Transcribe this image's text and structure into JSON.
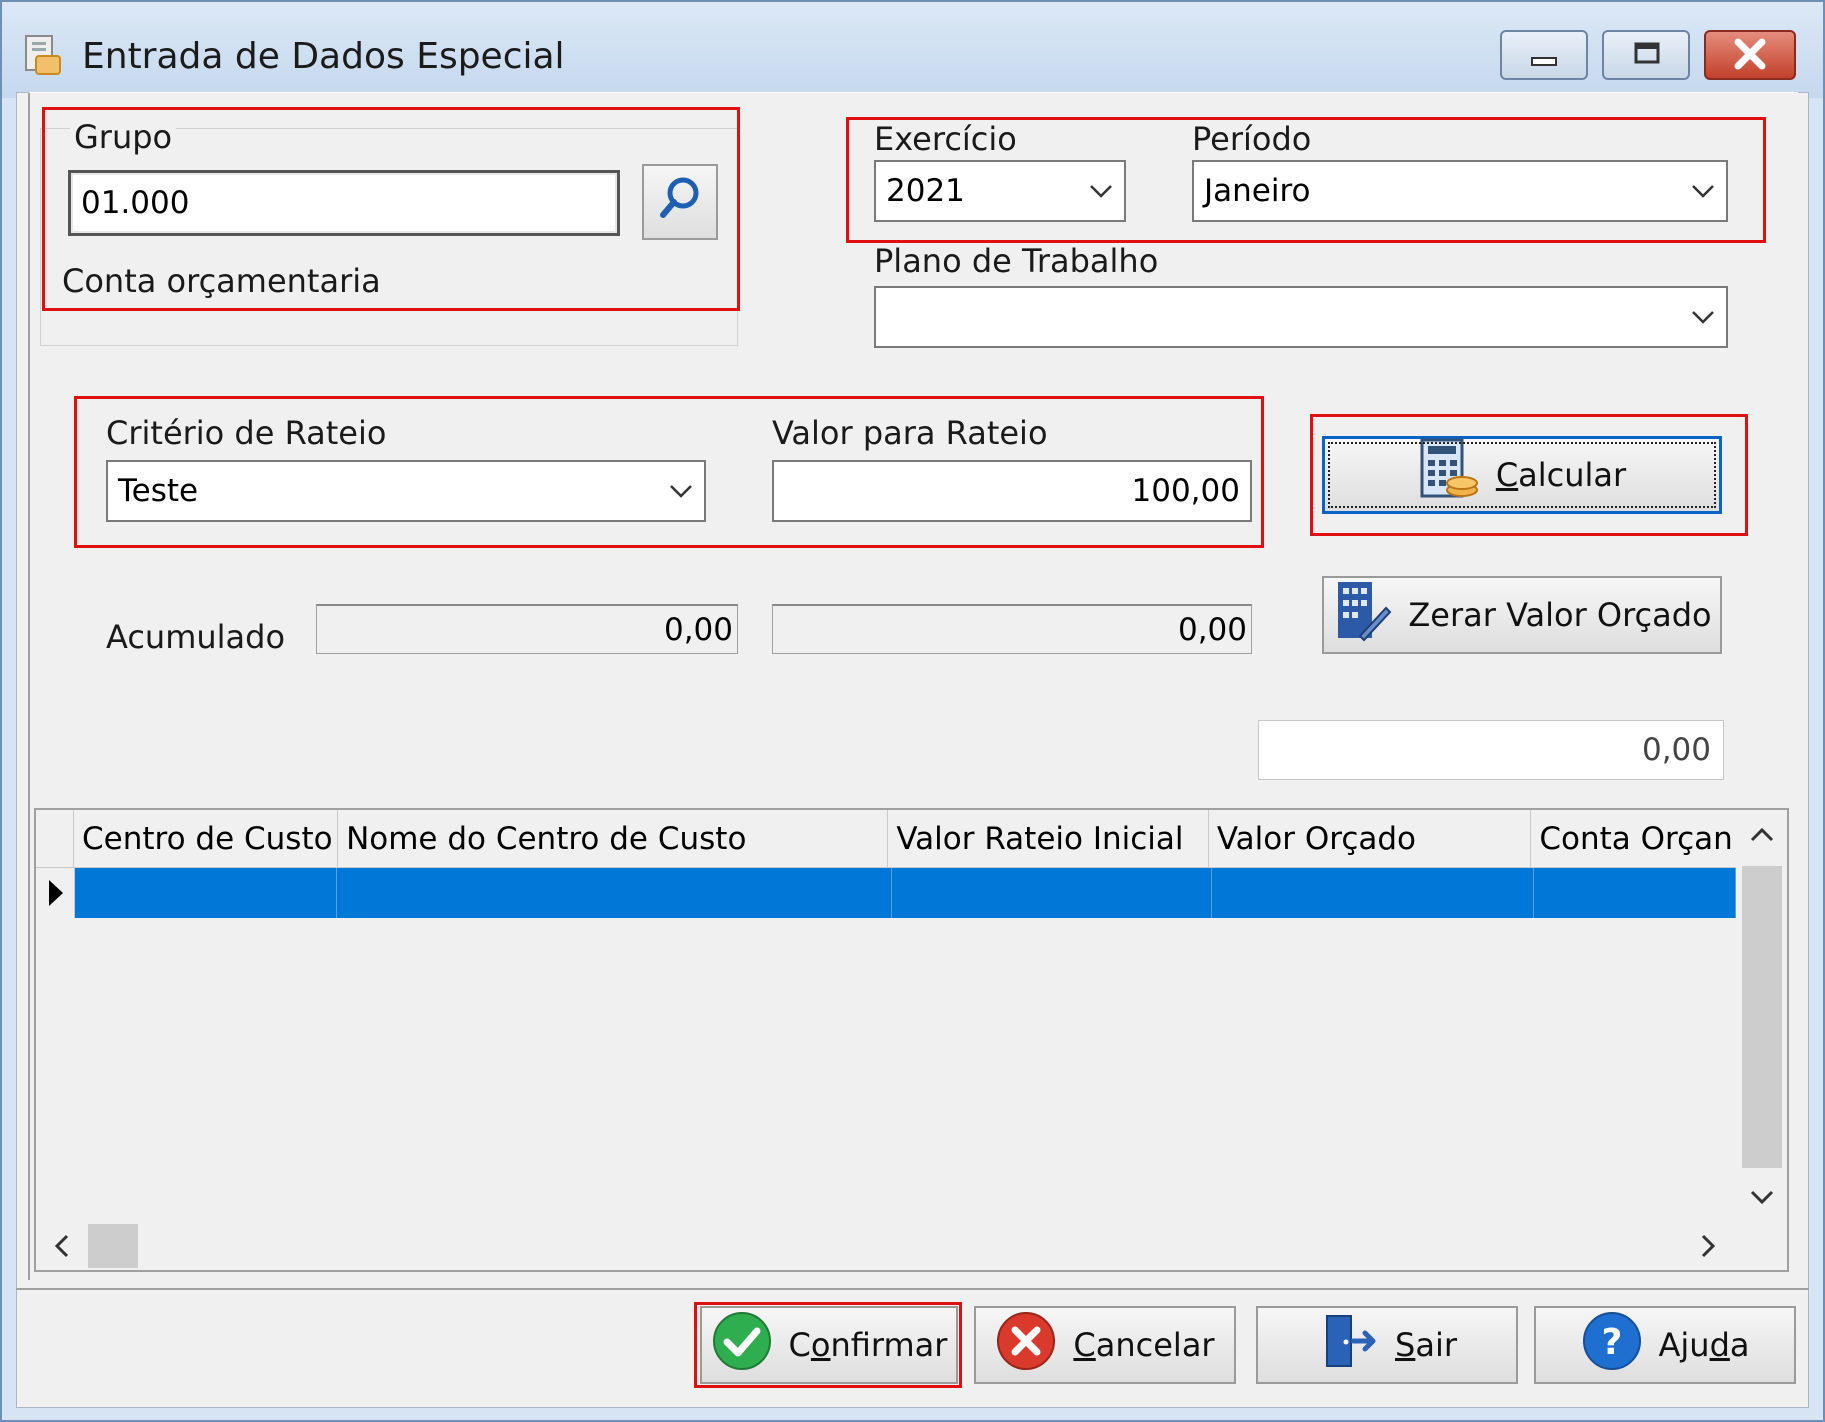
{
  "window": {
    "title": "Entrada de Dados Especial"
  },
  "grupo": {
    "label": "Grupo",
    "value": "01.000",
    "description": "Conta orçamentaria"
  },
  "exercicio": {
    "label": "Exercício",
    "value": "2021"
  },
  "periodo": {
    "label": "Período",
    "value": "Janeiro"
  },
  "plano": {
    "label": "Plano de Trabalho",
    "value": ""
  },
  "criterio": {
    "label": "Critério de Rateio",
    "value": "Teste"
  },
  "valor_rateio": {
    "label": "Valor para Rateio",
    "value": "100,00"
  },
  "calcular": {
    "label_first": "C",
    "label_rest": "alcular"
  },
  "zerar": {
    "label": "Zerar Valor Orçado"
  },
  "acumulado": {
    "label": "Acumulado",
    "value1": "0,00",
    "value2": "0,00"
  },
  "total": {
    "value": "0,00"
  },
  "grid": {
    "columns": [
      "Centro de Custo",
      "Nome do Centro de Custo",
      "Valor Rateio Inicial",
      "Valor Orçado",
      "Conta Orçan"
    ]
  },
  "footer": {
    "confirmar": {
      "pre": "C",
      "u": "o",
      "post": "nfirmar"
    },
    "cancelar": {
      "u": "C",
      "post": "ancelar"
    },
    "sair": {
      "u": "S",
      "post": "air"
    },
    "ajuda": {
      "pre": "Aju",
      "u": "d",
      "post": "a"
    }
  },
  "colors": {
    "selection": "#0078d7",
    "highlight_box": "#e01010",
    "confirm_green": "#2fae4f",
    "cancel_red": "#d93a2b",
    "help_blue": "#1f6fd1"
  }
}
